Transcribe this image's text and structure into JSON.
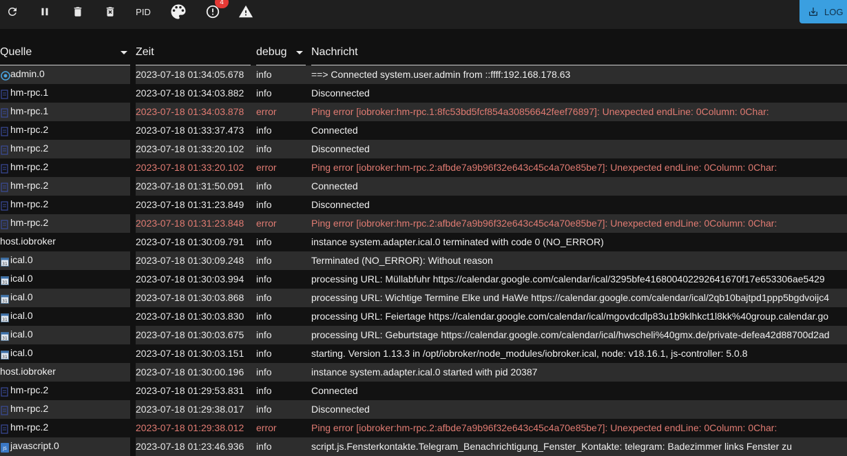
{
  "toolbar": {
    "pid_label": "PID",
    "notification_count": "4",
    "log_button_label": "LOG",
    "icons": [
      "refresh-icon",
      "pause-icon",
      "delete-icon",
      "delete-file-icon",
      "palette-icon",
      "alert-circle-icon",
      "warning-icon",
      "download-icon"
    ]
  },
  "columns": {
    "source": "Quelle",
    "time": "Zeit",
    "severity": "debug",
    "message": "Nachricht"
  },
  "colors": {
    "error_text": "#e07b72",
    "log_button": "#3a9fe0",
    "badge": "#e53935"
  },
  "rows": [
    {
      "source": "admin.0",
      "icon": "admin-icon",
      "time": "2023-07-18 01:34:05.678",
      "severity": "info",
      "message": "==> Connected system.user.admin from ::ffff:192.168.178.63"
    },
    {
      "source": "hm-rpc.1",
      "icon": "hm-rpc-icon",
      "time": "2023-07-18 01:34:03.882",
      "severity": "info",
      "message": "Disconnected"
    },
    {
      "source": "hm-rpc.1",
      "icon": "hm-rpc-icon",
      "time": "2023-07-18 01:34:03.878",
      "severity": "error",
      "message": "Ping error [iobroker:hm-rpc.1:8fc53bd5fcf854a30856642feef76897]: Unexpected endLine: 0Column: 0Char:"
    },
    {
      "source": "hm-rpc.2",
      "icon": "hm-rpc-icon",
      "time": "2023-07-18 01:33:37.473",
      "severity": "info",
      "message": "Connected"
    },
    {
      "source": "hm-rpc.2",
      "icon": "hm-rpc-icon",
      "time": "2023-07-18 01:33:20.102",
      "severity": "info",
      "message": "Disconnected"
    },
    {
      "source": "hm-rpc.2",
      "icon": "hm-rpc-icon",
      "time": "2023-07-18 01:33:20.102",
      "severity": "error",
      "message": "Ping error [iobroker:hm-rpc.2:afbde7a9b96f32e643c45c4a70e85be7]: Unexpected endLine: 0Column: 0Char:"
    },
    {
      "source": "hm-rpc.2",
      "icon": "hm-rpc-icon",
      "time": "2023-07-18 01:31:50.091",
      "severity": "info",
      "message": "Connected"
    },
    {
      "source": "hm-rpc.2",
      "icon": "hm-rpc-icon",
      "time": "2023-07-18 01:31:23.849",
      "severity": "info",
      "message": "Disconnected"
    },
    {
      "source": "hm-rpc.2",
      "icon": "hm-rpc-icon",
      "time": "2023-07-18 01:31:23.848",
      "severity": "error",
      "message": "Ping error [iobroker:hm-rpc.2:afbde7a9b96f32e643c45c4a70e85be7]: Unexpected endLine: 0Column: 0Char:"
    },
    {
      "source": "host.iobroker",
      "icon": "",
      "time": "2023-07-18 01:30:09.791",
      "severity": "info",
      "message": "instance system.adapter.ical.0 terminated with code 0 (NO_ERROR)"
    },
    {
      "source": "ical.0",
      "icon": "ical-icon",
      "time": "2023-07-18 01:30:09.248",
      "severity": "info",
      "message": "Terminated (NO_ERROR): Without reason"
    },
    {
      "source": "ical.0",
      "icon": "ical-icon",
      "time": "2023-07-18 01:30:03.994",
      "severity": "info",
      "message": "processing URL: Müllabfuhr https://calendar.google.com/calendar/ical/3295bfe416800402292641670f17e653306ae5429"
    },
    {
      "source": "ical.0",
      "icon": "ical-icon",
      "time": "2023-07-18 01:30:03.868",
      "severity": "info",
      "message": "processing URL: Wichtige Termine Elke und HaWe https://calendar.google.com/calendar/ical/2qb10bajtpd1ppp5bgdvoijc4"
    },
    {
      "source": "ical.0",
      "icon": "ical-icon",
      "time": "2023-07-18 01:30:03.830",
      "severity": "info",
      "message": "processing URL: Feiertage https://calendar.google.com/calendar/ical/mgovdcdlp83u1b9klhkct1l8kk%40group.calendar.go"
    },
    {
      "source": "ical.0",
      "icon": "ical-icon",
      "time": "2023-07-18 01:30:03.675",
      "severity": "info",
      "message": "processing URL: Geburtstage https://calendar.google.com/calendar/ical/hwscheli%40gmx.de/private-defea42d88700d2ad"
    },
    {
      "source": "ical.0",
      "icon": "ical-icon",
      "time": "2023-07-18 01:30:03.151",
      "severity": "info",
      "message": "starting. Version 1.13.3 in /opt/iobroker/node_modules/iobroker.ical, node: v18.16.1, js-controller: 5.0.8"
    },
    {
      "source": "host.iobroker",
      "icon": "",
      "time": "2023-07-18 01:30:00.196",
      "severity": "info",
      "message": "instance system.adapter.ical.0 started with pid 20387"
    },
    {
      "source": "hm-rpc.2",
      "icon": "hm-rpc-icon",
      "time": "2023-07-18 01:29:53.831",
      "severity": "info",
      "message": "Connected"
    },
    {
      "source": "hm-rpc.2",
      "icon": "hm-rpc-icon",
      "time": "2023-07-18 01:29:38.017",
      "severity": "info",
      "message": "Disconnected"
    },
    {
      "source": "hm-rpc.2",
      "icon": "hm-rpc-icon",
      "time": "2023-07-18 01:29:38.012",
      "severity": "error",
      "message": "Ping error [iobroker:hm-rpc.2:afbde7a9b96f32e643c45c4a70e85be7]: Unexpected endLine: 0Column: 0Char:"
    },
    {
      "source": "javascript.0",
      "icon": "javascript-icon",
      "time": "2023-07-18 01:23:46.936",
      "severity": "info",
      "message": "script.js.Fensterkontakte.Telegram_Benachrichtigung_Fenster_Kontakte: telegram: Badezimmer links Fenster zu"
    }
  ]
}
